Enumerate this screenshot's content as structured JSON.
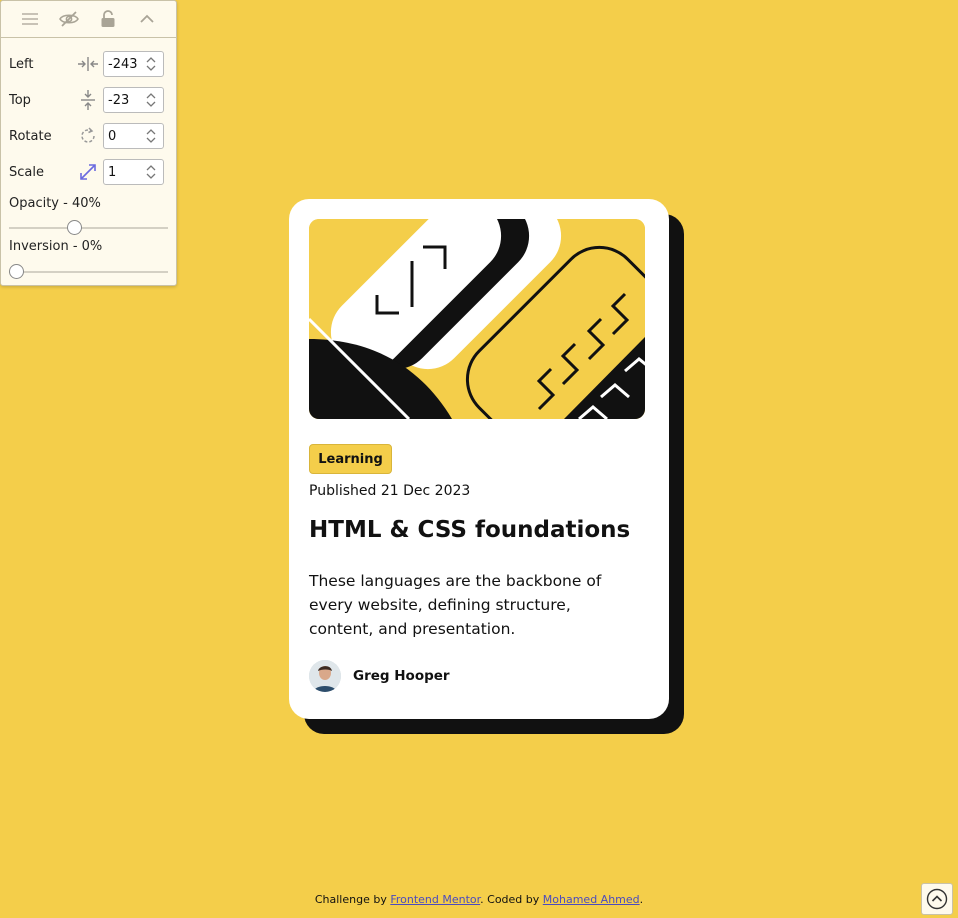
{
  "panel": {
    "toolbar": {
      "icons": [
        "menu-icon",
        "eye-off-icon",
        "lock-open-icon",
        "chevron-up-icon"
      ]
    },
    "fields": [
      {
        "label": "Left",
        "icon": "horizontal-align-icon",
        "value": "-243"
      },
      {
        "label": "Top",
        "icon": "vertical-align-icon",
        "value": "-23"
      },
      {
        "label": "Rotate",
        "icon": "rotate-icon",
        "value": "0"
      },
      {
        "label": "Scale",
        "icon": "expand-icon",
        "value": "1"
      }
    ],
    "opacity": {
      "label": "Opacity - 40%",
      "value": 0.4
    },
    "inversion": {
      "label": "Inversion - 0%",
      "value": 0
    }
  },
  "card": {
    "tag": "Learning",
    "published": "Published 21 Dec 2023",
    "title": "HTML & CSS foundations",
    "description": "These languages are the backbone of every website, defining structure, content, and presentation.",
    "author": "Greg Hooper"
  },
  "footer": {
    "prefix": "Challenge by ",
    "link1": "Frontend Mentor",
    "middle": ". Coded by ",
    "link2": "Mohamed Ahmed",
    "suffix": "."
  },
  "colors": {
    "background": "#f4ce4a",
    "card": "#ffffff",
    "shadow": "#111111",
    "link": "#4b4bbf"
  }
}
